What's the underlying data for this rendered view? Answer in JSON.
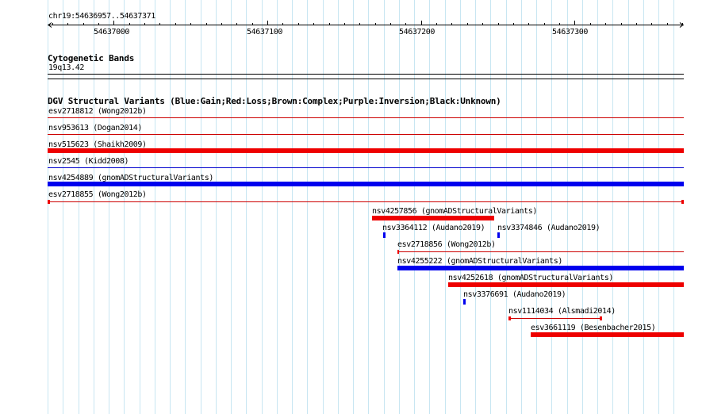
{
  "ruler": {
    "position": "chr19:54636957..54637371",
    "start": 54636957,
    "end": 54637371,
    "ticks": [
      {
        "label": "54637000",
        "value": 54637000
      },
      {
        "label": "54637100",
        "value": 54637100
      },
      {
        "label": "54637200",
        "value": 54637200
      },
      {
        "label": "54637300",
        "value": 54637300
      }
    ]
  },
  "cytoband": {
    "title": "Cytogenetic Bands",
    "band": "19q13.42"
  },
  "dgv": {
    "title": "DGV Structural Variants (Blue:Gain;Red:Loss;Brown:Complex;Purple:Inversion;Black:Unknown)",
    "colors": {
      "gain": "#0000ee",
      "loss": "#ee0000",
      "thin_line_gain": "#0000cc",
      "thin_line_loss": "#cc0000"
    },
    "features": [
      {
        "id": "esv2718812",
        "label": "esv2718812 (Wong2012b)",
        "type": "loss",
        "style": "line"
      },
      {
        "id": "nsv953613",
        "label": "nsv953613 (Dogan2014)",
        "type": "loss",
        "style": "line"
      },
      {
        "id": "nsv515623",
        "label": "nsv515623 (Shaikh2009)",
        "type": "loss",
        "style": "bar"
      },
      {
        "id": "nsv2545",
        "label": "nsv2545 (Kidd2008)",
        "type": "gain",
        "style": "line"
      },
      {
        "id": "nsv4254889",
        "label": "nsv4254889 (gnomADStructuralVariants)",
        "type": "gain",
        "style": "bar"
      },
      {
        "id": "esv2718855",
        "label": "esv2718855 (Wong2012b)",
        "type": "loss",
        "style": "line-capped"
      },
      {
        "id": "nsv4257856",
        "label": "nsv4257856 (gnomADStructuralVariants)",
        "type": "loss",
        "style": "bar"
      },
      {
        "id": "nsv3364112",
        "label": "nsv3364112 (Audano2019)",
        "type": "gain",
        "style": "tick"
      },
      {
        "id": "nsv3374846",
        "label": "nsv3374846 (Audano2019)",
        "type": "gain",
        "style": "tick"
      },
      {
        "id": "esv2718856",
        "label": "esv2718856 (Wong2012b)",
        "type": "loss",
        "style": "line"
      },
      {
        "id": "nsv4255222",
        "label": "nsv4255222 (gnomADStructuralVariants)",
        "type": "gain",
        "style": "bar"
      },
      {
        "id": "nsv4252618",
        "label": "nsv4252618 (gnomADStructuralVariants)",
        "type": "loss",
        "style": "bar"
      },
      {
        "id": "nsv3376691",
        "label": "nsv3376691 (Audano2019)",
        "type": "gain",
        "style": "tick"
      },
      {
        "id": "nsv1114034",
        "label": "nsv1114034 (Alsmadi2014)",
        "type": "loss",
        "style": "line-capped"
      },
      {
        "id": "esv3661119",
        "label": "esv3661119 (Besenbacher2015)",
        "type": "loss",
        "style": "bar"
      }
    ]
  }
}
